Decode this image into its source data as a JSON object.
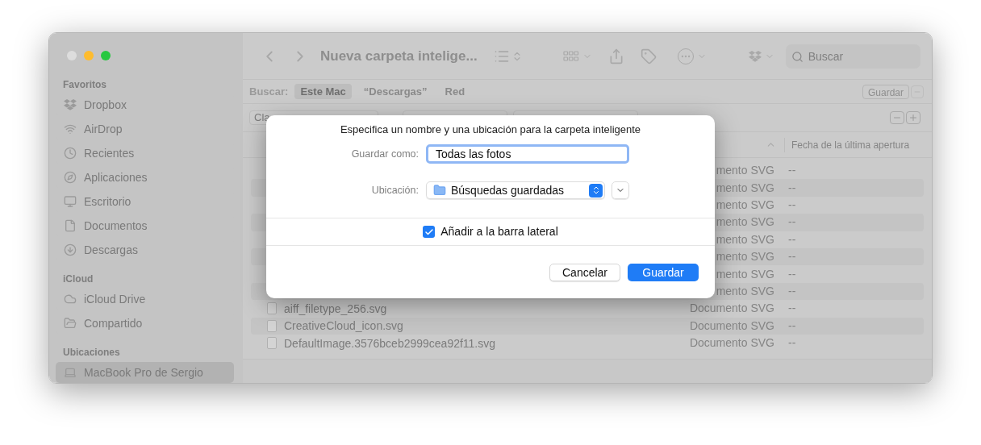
{
  "window": {
    "title": "Nueva carpeta intelige...",
    "traffic_lights": [
      {
        "color": "#dddddd"
      },
      {
        "color": "#febc2e"
      },
      {
        "color": "#28c840"
      }
    ]
  },
  "sidebar": {
    "sections": [
      {
        "title": "Favoritos",
        "items": [
          {
            "label": "Dropbox",
            "selected": false
          },
          {
            "label": "AirDrop",
            "selected": false
          },
          {
            "label": "Recientes",
            "selected": false
          },
          {
            "label": "Aplicaciones",
            "selected": false
          },
          {
            "label": "Escritorio",
            "selected": false
          },
          {
            "label": "Documentos",
            "selected": false
          },
          {
            "label": "Descargas",
            "selected": false
          }
        ]
      },
      {
        "title": "iCloud",
        "items": [
          {
            "label": "iCloud Drive",
            "selected": false
          },
          {
            "label": "Compartido",
            "selected": false
          }
        ]
      },
      {
        "title": "Ubicaciones",
        "items": [
          {
            "label": "MacBook Pro de Sergio",
            "selected": true
          }
        ]
      }
    ]
  },
  "toolbar": {
    "search": {
      "placeholder": "Buscar"
    }
  },
  "scope_bar": {
    "label": "Buscar:",
    "scopes": [
      {
        "label": "Este Mac",
        "selected": true
      },
      {
        "label": "“Descargas”",
        "selected": false
      },
      {
        "label": "Red",
        "selected": false
      }
    ],
    "save_button": "Guardar"
  },
  "filter_row": {
    "criteria_popup": "Cla"
  },
  "table": {
    "columns": [
      {
        "label": "Fecha de la última apertura"
      }
    ],
    "rows": [
      {
        "file_type": "mento SVG",
        "date": "--"
      },
      {
        "file_type": "mento SVG",
        "date": "--"
      },
      {
        "file_type": "mento SVG",
        "date": "--"
      },
      {
        "file_type": "mento SVG",
        "date": "--"
      },
      {
        "file_type": "mento SVG",
        "date": "--"
      },
      {
        "file_type": "mento SVG",
        "date": "--"
      },
      {
        "file_type": "mento SVG",
        "date": "--"
      },
      {
        "file_type": "mento SVG",
        "date": "--"
      },
      {
        "name": "aiff_filetype_256.svg",
        "file_type": "Documento SVG",
        "date": "--"
      },
      {
        "name": "CreativeCloud_icon.svg",
        "file_type": "Documento SVG",
        "date": "--"
      },
      {
        "name": "DefaultImage.3576bceb2999cea92f11.svg",
        "file_type": "Documento SVG",
        "date": "--"
      }
    ]
  },
  "dialog": {
    "message": "Especifica un nombre y una ubicación para la carpeta inteligente",
    "name_label": "Guardar como:",
    "name_value": "Todas las fotos",
    "location_label": "Ubicación:",
    "location_value": "Búsquedas guardadas",
    "add_to_sidebar": {
      "label": "Añadir a la barra lateral",
      "checked": true
    },
    "buttons": [
      {
        "label": "Cancelar",
        "kind": "secondary"
      },
      {
        "label": "Guardar",
        "kind": "default"
      }
    ]
  }
}
